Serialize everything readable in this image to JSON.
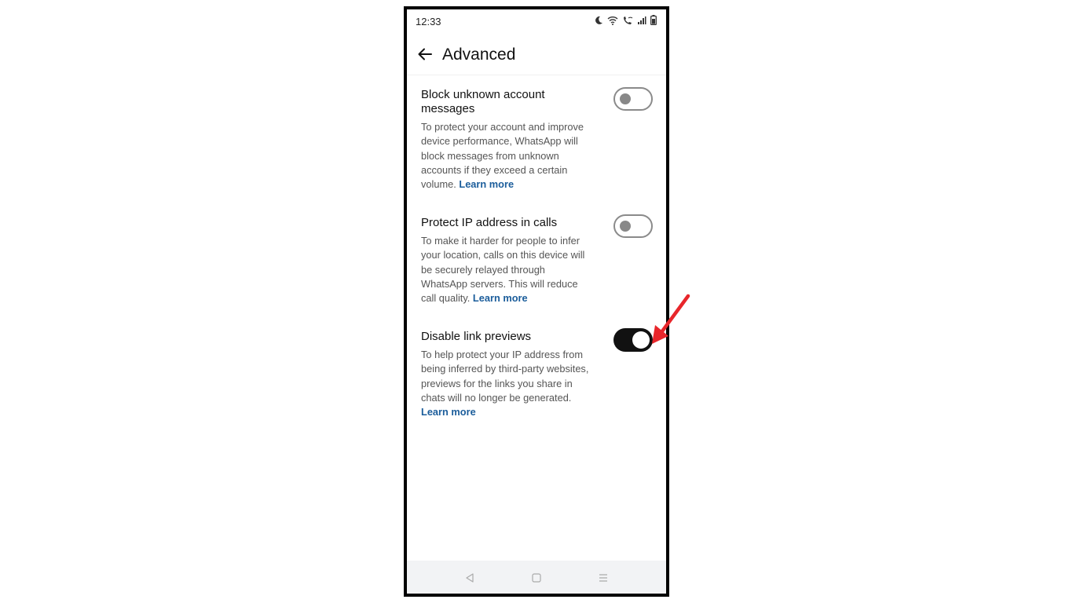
{
  "status_bar": {
    "time": "12:33",
    "icons": [
      "moon-icon",
      "wifi-icon",
      "wifi-call-icon",
      "signal-icon",
      "battery-icon"
    ]
  },
  "app_bar": {
    "back_icon": "arrow-left-icon",
    "title": "Advanced"
  },
  "settings": [
    {
      "title": "Block unknown account messages",
      "description": "To protect your account and improve device performance, WhatsApp will block messages from unknown accounts if they exceed a certain volume.",
      "link": "Learn more",
      "enabled": false
    },
    {
      "title": "Protect IP address in calls",
      "description": "To make it harder for people to infer your location, calls on this device will be securely relayed through WhatsApp servers. This will reduce call quality.",
      "link": "Learn more",
      "enabled": false
    },
    {
      "title": "Disable link previews",
      "description": "To help protect your IP address from being inferred by third-party websites, previews for the links you share in chats will no longer be generated.",
      "link": "Learn more",
      "enabled": true
    }
  ],
  "nav_bar": {
    "icons": [
      "back-triangle-icon",
      "home-square-icon",
      "recents-menu-icon"
    ]
  },
  "colors": {
    "link": "#1b5d9b",
    "toggle_on": "#111111",
    "toggle_off_border": "#8a8a8a",
    "annotation_arrow": "#e8262b"
  }
}
